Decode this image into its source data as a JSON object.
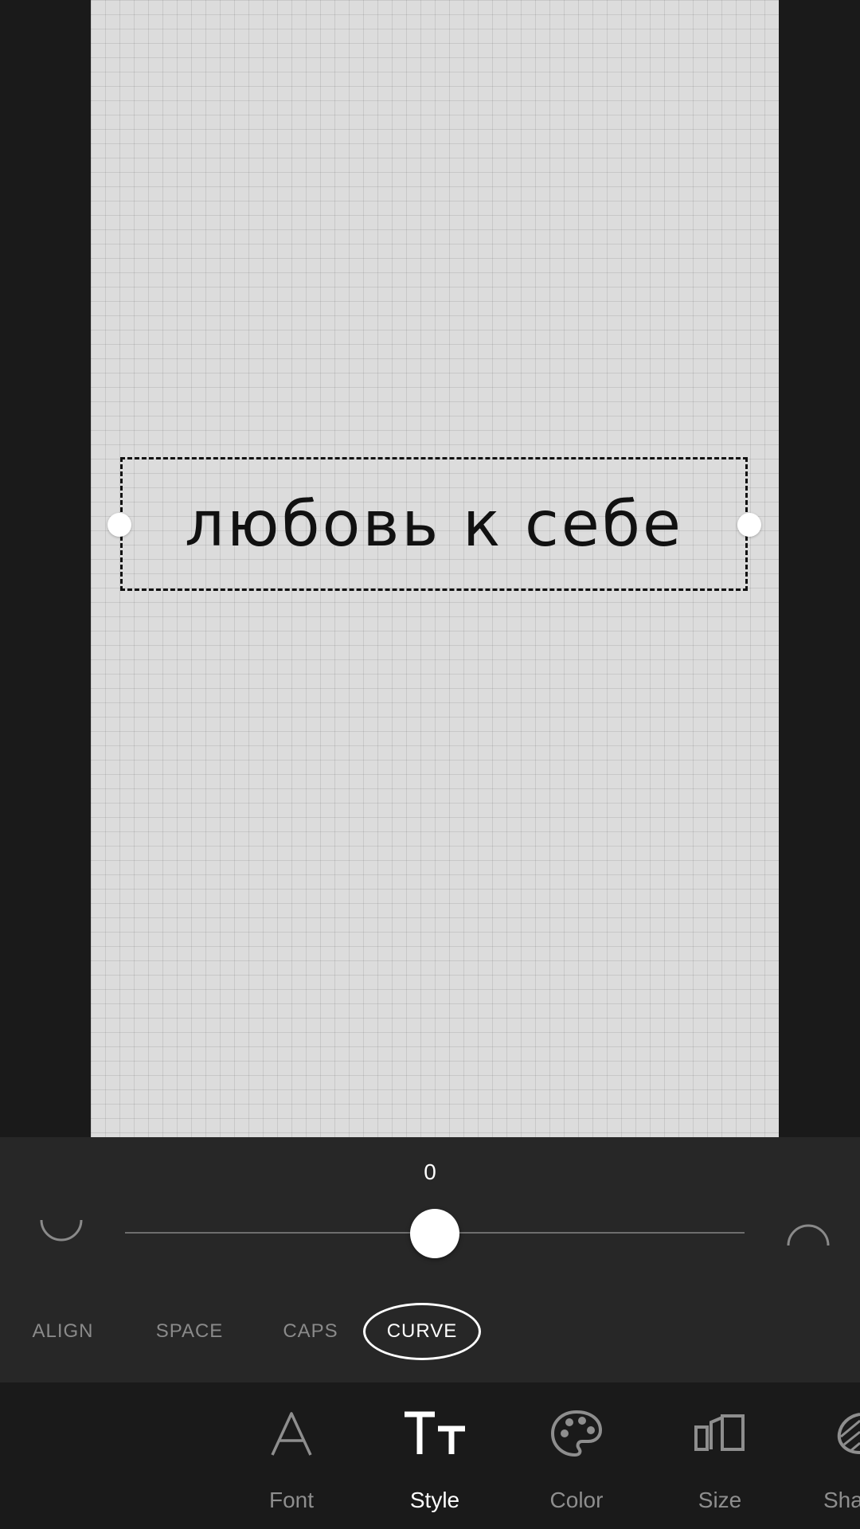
{
  "canvas": {
    "text": "любовь к себе"
  },
  "curve_panel": {
    "value": "0",
    "slider_fraction": 0.5,
    "left_icon": "curve-down-icon",
    "right_icon": "curve-up-icon"
  },
  "style_tabs": [
    {
      "label": "ALIGN",
      "active": false
    },
    {
      "label": "SPACE",
      "active": false
    },
    {
      "label": "CAPS",
      "active": false
    },
    {
      "label": "CURVE",
      "active": true
    }
  ],
  "toolbar": [
    {
      "label": "Font",
      "icon": "font-icon",
      "active": false
    },
    {
      "label": "Style",
      "icon": "style-icon",
      "active": true
    },
    {
      "label": "Color",
      "icon": "palette-icon",
      "active": false
    },
    {
      "label": "Size",
      "icon": "size-icon",
      "active": false
    },
    {
      "label": "Sha",
      "icon": "shape-icon",
      "active": false
    }
  ],
  "colors": {
    "background": "#1a1a1a",
    "canvas": "#dcdcdc",
    "panel": "#272727",
    "active": "#ffffff",
    "inactive": "#8e8e8e"
  }
}
